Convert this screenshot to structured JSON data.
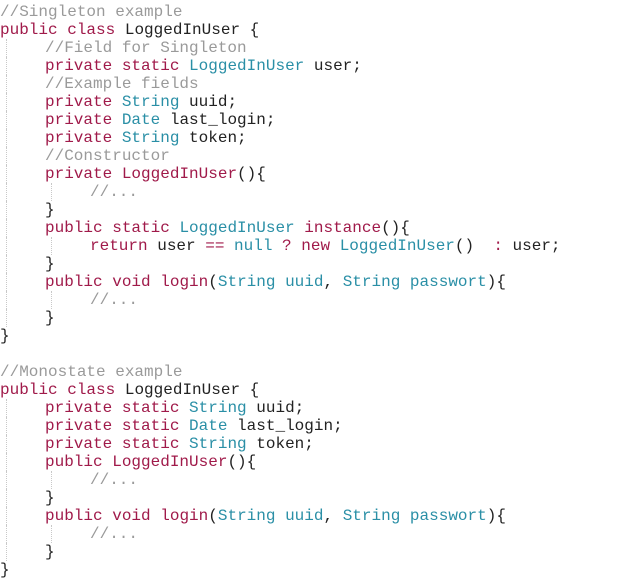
{
  "code_lines": [
    {
      "indent": 0,
      "tokens": [
        {
          "t": "comment",
          "v": "//Singleton example"
        }
      ]
    },
    {
      "indent": 0,
      "tokens": [
        {
          "t": "keyword",
          "v": "public"
        },
        {
          "t": "plain",
          "v": " "
        },
        {
          "t": "keyword",
          "v": "class"
        },
        {
          "t": "plain",
          "v": " LoggedInUser {"
        }
      ]
    },
    {
      "indent": 1,
      "tokens": [
        {
          "t": "comment",
          "v": "//Field for Singleton"
        }
      ]
    },
    {
      "indent": 1,
      "tokens": [
        {
          "t": "keyword",
          "v": "private"
        },
        {
          "t": "plain",
          "v": " "
        },
        {
          "t": "keyword",
          "v": "static"
        },
        {
          "t": "plain",
          "v": " "
        },
        {
          "t": "type",
          "v": "LoggedInUser"
        },
        {
          "t": "plain",
          "v": " user;"
        }
      ]
    },
    {
      "indent": 1,
      "tokens": [
        {
          "t": "comment",
          "v": "//Example fields"
        }
      ]
    },
    {
      "indent": 1,
      "tokens": [
        {
          "t": "keyword",
          "v": "private"
        },
        {
          "t": "plain",
          "v": " "
        },
        {
          "t": "type",
          "v": "String"
        },
        {
          "t": "plain",
          "v": " uuid;"
        }
      ]
    },
    {
      "indent": 1,
      "tokens": [
        {
          "t": "keyword",
          "v": "private"
        },
        {
          "t": "plain",
          "v": " "
        },
        {
          "t": "type",
          "v": "Date"
        },
        {
          "t": "plain",
          "v": " last_login;"
        }
      ]
    },
    {
      "indent": 1,
      "tokens": [
        {
          "t": "keyword",
          "v": "private"
        },
        {
          "t": "plain",
          "v": " "
        },
        {
          "t": "type",
          "v": "String"
        },
        {
          "t": "plain",
          "v": " token;"
        }
      ]
    },
    {
      "indent": 1,
      "tokens": [
        {
          "t": "comment",
          "v": "//Constructor"
        }
      ]
    },
    {
      "indent": 1,
      "tokens": [
        {
          "t": "keyword",
          "v": "private"
        },
        {
          "t": "plain",
          "v": " "
        },
        {
          "t": "func",
          "v": "LoggedInUser"
        },
        {
          "t": "plain",
          "v": "(){"
        }
      ]
    },
    {
      "indent": 2,
      "tokens": [
        {
          "t": "comment",
          "v": "//..."
        }
      ]
    },
    {
      "indent": 1,
      "tokens": [
        {
          "t": "plain",
          "v": "}"
        }
      ]
    },
    {
      "indent": 1,
      "tokens": [
        {
          "t": "keyword",
          "v": "public"
        },
        {
          "t": "plain",
          "v": " "
        },
        {
          "t": "keyword",
          "v": "static"
        },
        {
          "t": "plain",
          "v": " "
        },
        {
          "t": "type",
          "v": "LoggedInUser"
        },
        {
          "t": "plain",
          "v": " "
        },
        {
          "t": "func",
          "v": "instance"
        },
        {
          "t": "plain",
          "v": "(){"
        }
      ]
    },
    {
      "indent": 2,
      "tokens": [
        {
          "t": "keyword",
          "v": "return"
        },
        {
          "t": "plain",
          "v": " user "
        },
        {
          "t": "keyword",
          "v": "=="
        },
        {
          "t": "plain",
          "v": " "
        },
        {
          "t": "type",
          "v": "null"
        },
        {
          "t": "plain",
          "v": " "
        },
        {
          "t": "keyword",
          "v": "?"
        },
        {
          "t": "plain",
          "v": " "
        },
        {
          "t": "keyword",
          "v": "new"
        },
        {
          "t": "plain",
          "v": " "
        },
        {
          "t": "type",
          "v": "LoggedInUser"
        },
        {
          "t": "plain",
          "v": "() "
        },
        {
          "t": "keyword",
          "v": " :"
        },
        {
          "t": "plain",
          "v": " user;"
        }
      ]
    },
    {
      "indent": 1,
      "tokens": [
        {
          "t": "plain",
          "v": "}"
        }
      ]
    },
    {
      "indent": 1,
      "tokens": [
        {
          "t": "keyword",
          "v": "public"
        },
        {
          "t": "plain",
          "v": " "
        },
        {
          "t": "keyword",
          "v": "void"
        },
        {
          "t": "plain",
          "v": " "
        },
        {
          "t": "func",
          "v": "login"
        },
        {
          "t": "plain",
          "v": "("
        },
        {
          "t": "type",
          "v": "String"
        },
        {
          "t": "plain",
          "v": " "
        },
        {
          "t": "type",
          "v": "uuid"
        },
        {
          "t": "plain",
          "v": ", "
        },
        {
          "t": "type",
          "v": "String"
        },
        {
          "t": "plain",
          "v": " "
        },
        {
          "t": "type",
          "v": "passwort"
        },
        {
          "t": "plain",
          "v": "){"
        }
      ]
    },
    {
      "indent": 2,
      "tokens": [
        {
          "t": "comment",
          "v": "//..."
        }
      ]
    },
    {
      "indent": 1,
      "tokens": [
        {
          "t": "plain",
          "v": "}"
        }
      ]
    },
    {
      "indent": 0,
      "tokens": [
        {
          "t": "plain",
          "v": "}"
        }
      ]
    },
    {
      "indent": 0,
      "tokens": []
    },
    {
      "indent": 0,
      "tokens": [
        {
          "t": "comment",
          "v": "//Monostate example"
        }
      ]
    },
    {
      "indent": 0,
      "tokens": [
        {
          "t": "keyword",
          "v": "public"
        },
        {
          "t": "plain",
          "v": " "
        },
        {
          "t": "keyword",
          "v": "class"
        },
        {
          "t": "plain",
          "v": " LoggedInUser {"
        }
      ]
    },
    {
      "indent": 1,
      "tokens": [
        {
          "t": "keyword",
          "v": "private"
        },
        {
          "t": "plain",
          "v": " "
        },
        {
          "t": "keyword",
          "v": "static"
        },
        {
          "t": "plain",
          "v": " "
        },
        {
          "t": "type",
          "v": "String"
        },
        {
          "t": "plain",
          "v": " uuid;"
        }
      ]
    },
    {
      "indent": 1,
      "tokens": [
        {
          "t": "keyword",
          "v": "private"
        },
        {
          "t": "plain",
          "v": " "
        },
        {
          "t": "keyword",
          "v": "static"
        },
        {
          "t": "plain",
          "v": " "
        },
        {
          "t": "type",
          "v": "Date"
        },
        {
          "t": "plain",
          "v": " last_login;"
        }
      ]
    },
    {
      "indent": 1,
      "tokens": [
        {
          "t": "keyword",
          "v": "private"
        },
        {
          "t": "plain",
          "v": " "
        },
        {
          "t": "keyword",
          "v": "static"
        },
        {
          "t": "plain",
          "v": " "
        },
        {
          "t": "type",
          "v": "String"
        },
        {
          "t": "plain",
          "v": " token;"
        }
      ]
    },
    {
      "indent": 1,
      "tokens": [
        {
          "t": "keyword",
          "v": "public"
        },
        {
          "t": "plain",
          "v": " "
        },
        {
          "t": "func",
          "v": "LoggedInUser"
        },
        {
          "t": "plain",
          "v": "(){"
        }
      ]
    },
    {
      "indent": 2,
      "tokens": [
        {
          "t": "comment",
          "v": "//..."
        }
      ]
    },
    {
      "indent": 1,
      "tokens": [
        {
          "t": "plain",
          "v": "}"
        }
      ]
    },
    {
      "indent": 1,
      "tokens": [
        {
          "t": "keyword",
          "v": "public"
        },
        {
          "t": "plain",
          "v": " "
        },
        {
          "t": "keyword",
          "v": "void"
        },
        {
          "t": "plain",
          "v": " "
        },
        {
          "t": "func",
          "v": "login"
        },
        {
          "t": "plain",
          "v": "("
        },
        {
          "t": "type",
          "v": "String"
        },
        {
          "t": "plain",
          "v": " "
        },
        {
          "t": "type",
          "v": "uuid"
        },
        {
          "t": "plain",
          "v": ", "
        },
        {
          "t": "type",
          "v": "String"
        },
        {
          "t": "plain",
          "v": " "
        },
        {
          "t": "type",
          "v": "passwort"
        },
        {
          "t": "plain",
          "v": "){"
        }
      ]
    },
    {
      "indent": 2,
      "tokens": [
        {
          "t": "comment",
          "v": "//..."
        }
      ]
    },
    {
      "indent": 1,
      "tokens": [
        {
          "t": "plain",
          "v": "}"
        }
      ]
    },
    {
      "indent": 0,
      "tokens": [
        {
          "t": "plain",
          "v": "}"
        }
      ]
    }
  ],
  "colors": {
    "comment": "#9a9a9a",
    "keyword": "#a01a4a",
    "type": "#2a8fa6",
    "plain": "#222222",
    "background": "#ffffff"
  }
}
